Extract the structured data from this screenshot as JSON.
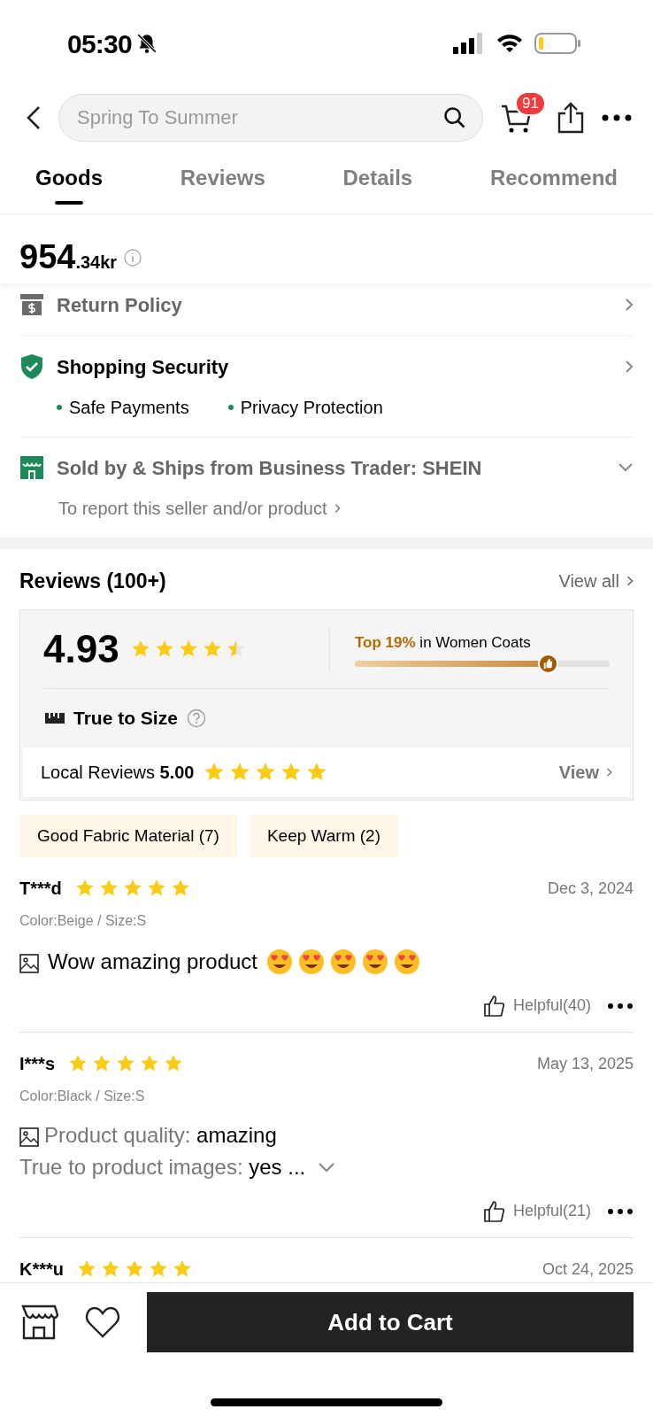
{
  "status_bar": {
    "time": "05:30",
    "silent": true
  },
  "header": {
    "search_placeholder": "Spring To Summer",
    "cart_count": "91"
  },
  "tabs": [
    {
      "label": "Goods",
      "selected": true
    },
    {
      "label": "Reviews",
      "selected": false
    },
    {
      "label": "Details",
      "selected": false
    },
    {
      "label": "Recommend",
      "selected": false
    }
  ],
  "price": {
    "main": "954",
    "fraction": ".34kr"
  },
  "services": [
    {
      "kind": "return",
      "title": "Return Policy"
    },
    {
      "kind": "security",
      "title": "Shopping Security",
      "points": [
        "Safe Payments",
        "Privacy Protection"
      ]
    },
    {
      "kind": "seller",
      "title": "Sold by & Ships from Business Trader: SHEIN",
      "expanded": false,
      "link": "To report this seller and/or product"
    }
  ],
  "reviews": {
    "title": "Reviews (100+)",
    "view_all": "View all",
    "rating": "4.93",
    "stars": 4.5,
    "rank": {
      "highlight": "Top 19%",
      "text": "in Women Coats",
      "level": 0.76
    },
    "fit": "True to Size",
    "local": {
      "label": "Local Reviews",
      "score": "5.00",
      "stars": 5,
      "link": "View"
    },
    "tags": [
      "Good Fabric Material (7)",
      "Keep Warm (2)"
    ],
    "items": [
      {
        "user": "T***d",
        "stars": 5,
        "date": "Dec 3, 2024",
        "variant": "Color:Beige / Size:S",
        "text": "Wow amazing product",
        "emojis": [
          {
            "kind": "heart_eyes"
          },
          {
            "kind": "heart_eyes"
          },
          {
            "kind": "heart_eyes"
          },
          {
            "kind": "heart_eyes"
          },
          {
            "kind": "heart_eyes"
          }
        ],
        "helpful": "Helpful(40)"
      },
      {
        "user": "I***s",
        "stars": 5,
        "date": "May 13, 2025",
        "variant": "Color:Black / Size:S",
        "lines": [
          {
            "label": "Product quality:",
            "value": "amazing"
          },
          {
            "label": "True to product images:",
            "value": "yes ..."
          }
        ],
        "collapsed": true,
        "helpful": "Helpful(21)"
      },
      {
        "user": "K***u",
        "stars": 5,
        "date": "Oct 24, 2025"
      }
    ]
  },
  "bottom_bar": {
    "button": "Add to Cart"
  }
}
